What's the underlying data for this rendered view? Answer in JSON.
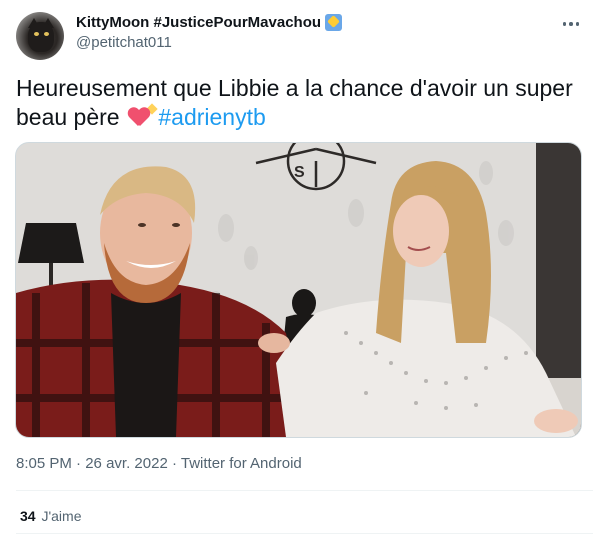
{
  "author": {
    "display_name": "KittyMoon #JusticePourMavachou",
    "handle": "@petitchat011",
    "name_emoji": "shooting-star-emoji",
    "avatar": "cat-avatar"
  },
  "tweet": {
    "text_before": "Heureusement que Libbie a la chance d'avoir un super beau père ",
    "emoji": "sparkling-heart-emoji",
    "hashtag": "#adrienytb"
  },
  "meta": {
    "time": "8:05 PM",
    "separator1": " · ",
    "date": "26 avr. 2022",
    "separator2": " · ",
    "source": "Twitter for Android"
  },
  "stats": {
    "likes_count": "34",
    "likes_label": "J'aime"
  },
  "colors": {
    "link": "#1d9bf0",
    "text": "#0f1419",
    "secondary": "#536471"
  }
}
